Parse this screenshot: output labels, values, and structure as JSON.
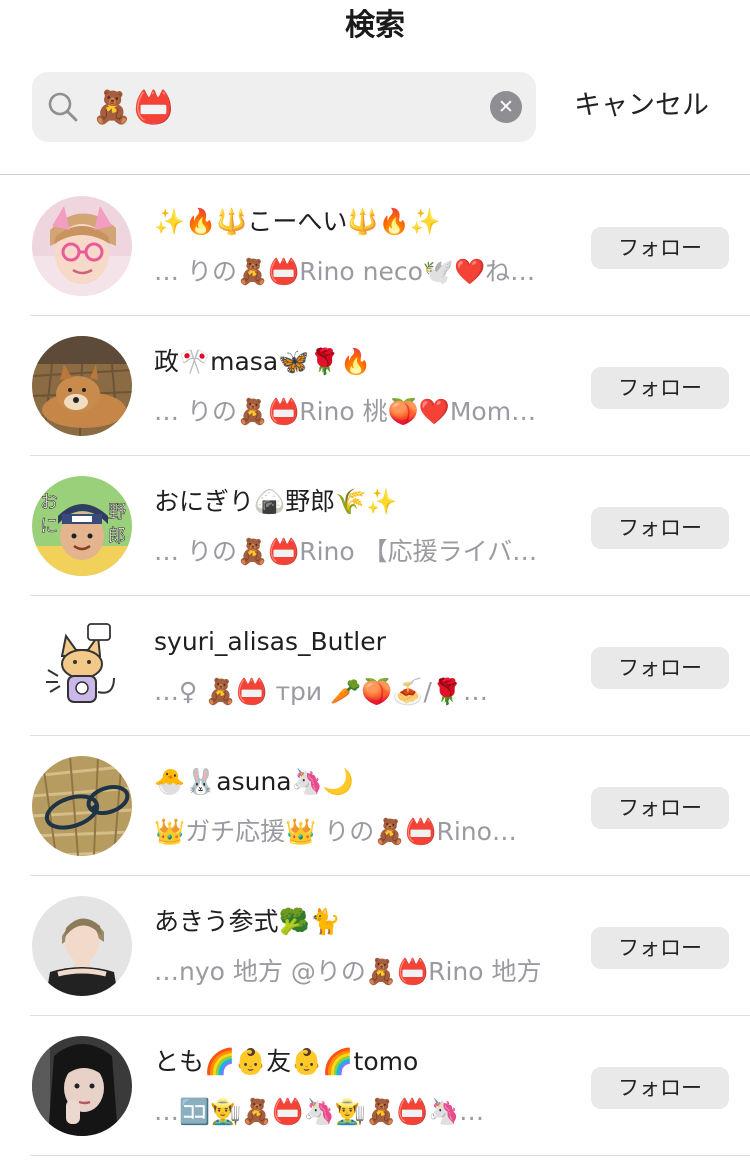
{
  "header": {
    "title": "検索"
  },
  "search": {
    "query": "🧸📛",
    "cancel_label": "キャンセル",
    "clear_glyph": "✕"
  },
  "results": [
    {
      "name": "✨🔥🔱こーへい🔱🔥✨",
      "description": "… りの🧸📛Rino neco🕊️❤️ね…",
      "follow_label": "フォロー"
    },
    {
      "name": "政🎌masa🦋🌹🔥",
      "description": "… りの🧸📛Rino 桃🍑❤️Mom…",
      "follow_label": "フォロー"
    },
    {
      "name": "おにぎり🍙野郎🌾✨",
      "description": "… りの🧸📛Rino 【応援ライバ…",
      "follow_label": "フォロー"
    },
    {
      "name": "syuri_alisas_Butler",
      "description": "…♀ 🧸📛 три 🥕🍑🍝/🌹…",
      "follow_label": "フォロー"
    },
    {
      "name": "🐣🐰asuna🦄🌙",
      "description": "👑ガチ応援👑 りの🧸📛Rino…",
      "follow_label": "フォロー"
    },
    {
      "name": "あきう参式🥦🐈",
      "description": "…nyo 地方 @りの🧸📛Rino 地方",
      "follow_label": "フォロー"
    },
    {
      "name": "とも🌈👶友👶🌈tomo",
      "description": "…🈁👨‍🌾🧸📛🦄👨‍🌾🧸📛🦄…",
      "follow_label": "フォロー"
    }
  ]
}
